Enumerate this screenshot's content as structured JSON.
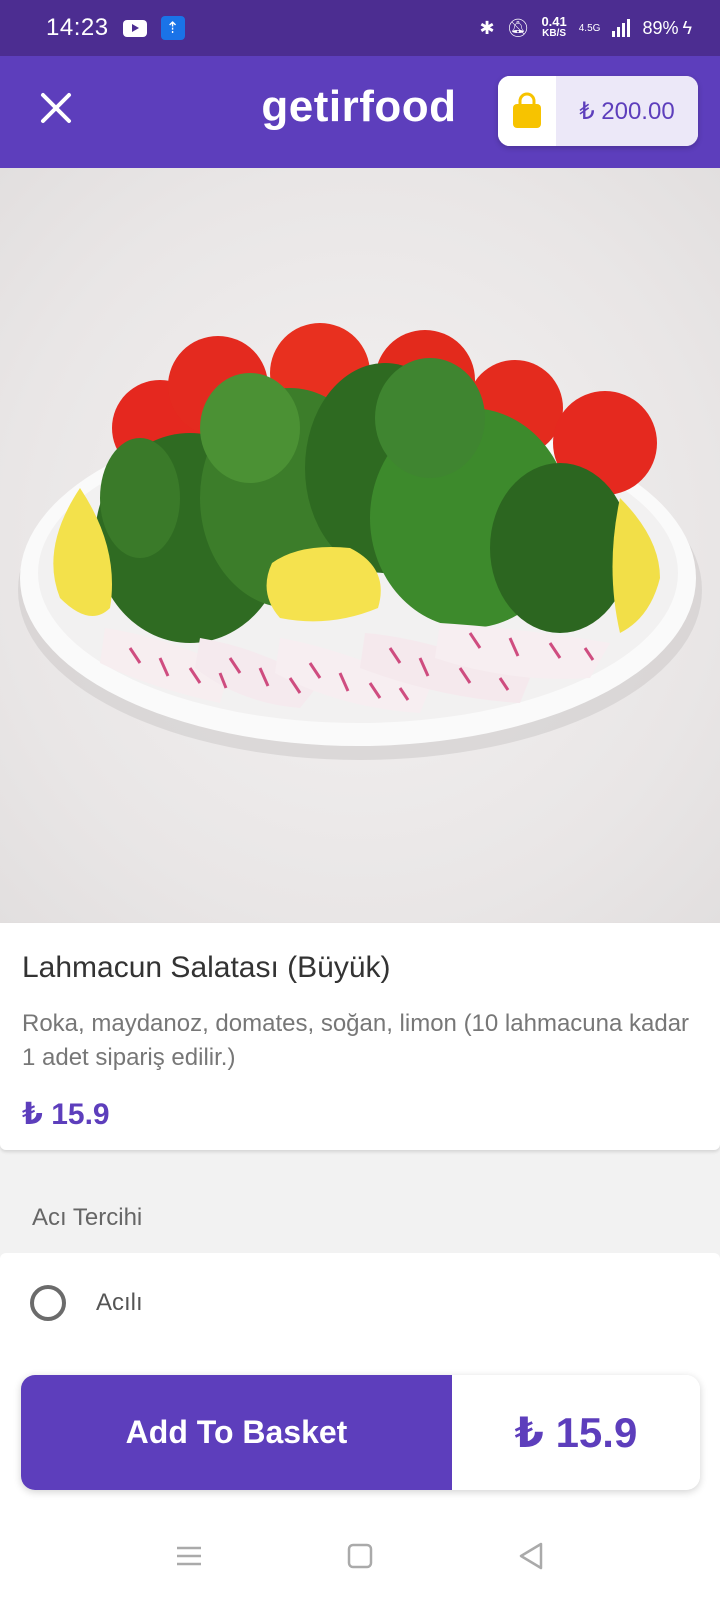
{
  "status_bar": {
    "time": "14:23",
    "net_speed": "0.41",
    "net_unit": "KB/S",
    "network": "4.5G",
    "battery": "89%"
  },
  "app_bar": {
    "title": "getirfood",
    "basket_amount": "₺ 200.00"
  },
  "product": {
    "name": "Lahmacun Salatası (Büyük)",
    "description": "Roka, maydanoz, domates, soğan, limon (10 lahmacuna kadar 1 adet sipariş edilir.)",
    "price": "₺ 15.9"
  },
  "options": {
    "section_title": "Acı Tercihi",
    "items": [
      {
        "label": "Acılı",
        "selected": false
      }
    ]
  },
  "action": {
    "add_label": "Add To Basket",
    "total": "₺ 15.9"
  },
  "colors": {
    "status_bar": "#4c2d91",
    "brand": "#5d3ebc",
    "basket_icon": "#f7c300"
  }
}
